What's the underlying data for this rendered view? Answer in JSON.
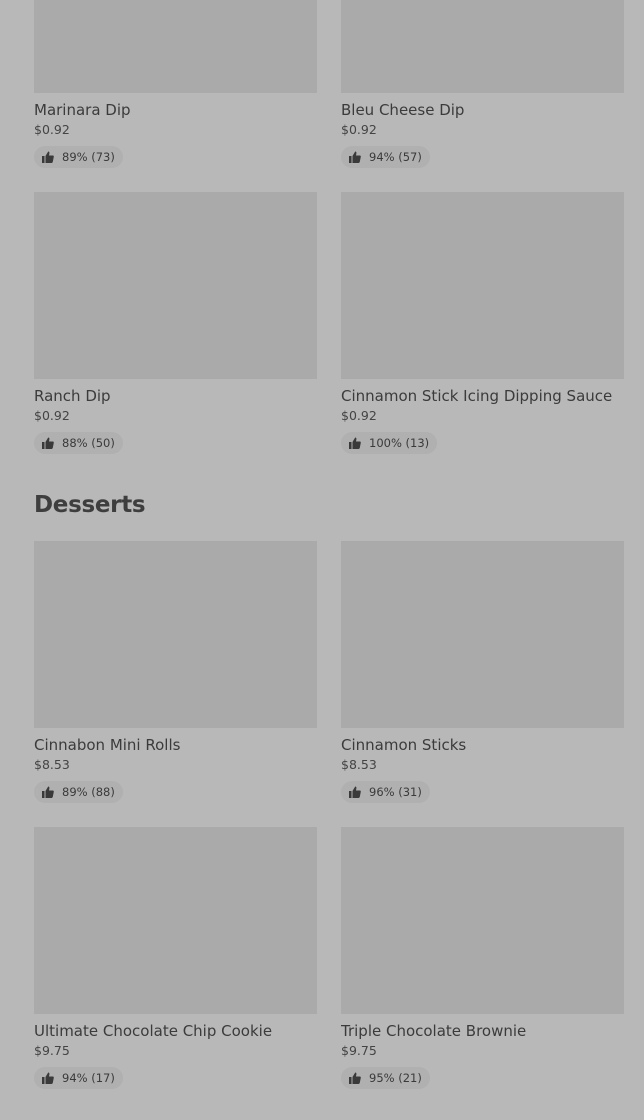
{
  "sections": [
    {
      "title": "",
      "items": [
        {
          "name": "Marinara Dip",
          "price": "$0.92",
          "rating": "89% (73)"
        },
        {
          "name": "Bleu Cheese Dip",
          "price": "$0.92",
          "rating": "94% (57)"
        },
        {
          "name": "Ranch Dip",
          "price": "$0.92",
          "rating": "88% (50)"
        },
        {
          "name": "Cinnamon Stick Icing Dipping Sauce",
          "price": "$0.92",
          "rating": "100% (13)"
        }
      ]
    },
    {
      "title": "Desserts",
      "items": [
        {
          "name": "Cinnabon Mini Rolls",
          "price": "$8.53",
          "rating": "89% (88)"
        },
        {
          "name": "Cinnamon Sticks",
          "price": "$8.53",
          "rating": "96% (31)"
        },
        {
          "name": "Ultimate Chocolate Chip Cookie",
          "price": "$9.75",
          "rating": "94% (17)"
        },
        {
          "name": "Triple Chocolate Brownie",
          "price": "$9.75",
          "rating": "95% (21)"
        }
      ]
    }
  ],
  "icons": {
    "rating": "thumbs-up-icon"
  }
}
